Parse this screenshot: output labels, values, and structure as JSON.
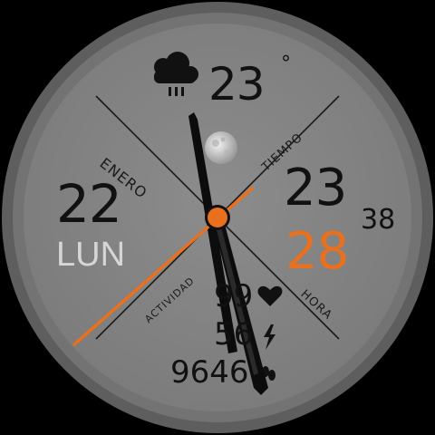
{
  "weather": {
    "icon": "cloud-rain-icon",
    "temperature": "23",
    "unit": "°"
  },
  "date": {
    "day": "22",
    "weekday": "LUN",
    "month": "ENERO"
  },
  "time": {
    "hour": "23",
    "minute": "28",
    "second": "38"
  },
  "labels": {
    "tiempo": "TIEMPO",
    "actividad": "ACTIVIDAD",
    "hora": "HORA"
  },
  "stats": {
    "heart_rate": "99",
    "heart_icon": "heart-icon",
    "battery": "56",
    "battery_icon": "lightning-icon",
    "steps": "9646",
    "steps_icon": "footprints-icon"
  },
  "moon_icon": "moon-icon",
  "colors": {
    "accent": "#e8701e",
    "face": "#8a8a8a",
    "bezel": "#6f6f6f",
    "text": "#111111",
    "weekday": "#d6d6d6"
  }
}
